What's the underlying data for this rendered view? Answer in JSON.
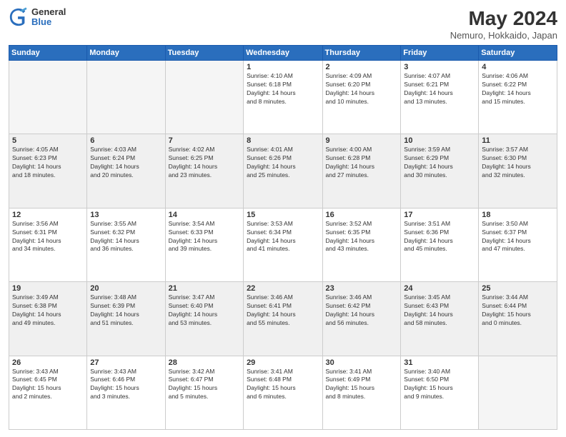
{
  "header": {
    "logo_general": "General",
    "logo_blue": "Blue",
    "title": "May 2024",
    "subtitle": "Nemuro, Hokkaido, Japan"
  },
  "weekdays": [
    "Sunday",
    "Monday",
    "Tuesday",
    "Wednesday",
    "Thursday",
    "Friday",
    "Saturday"
  ],
  "weeks": [
    [
      {
        "day": "",
        "info": "",
        "empty": true
      },
      {
        "day": "",
        "info": "",
        "empty": true
      },
      {
        "day": "",
        "info": "",
        "empty": true
      },
      {
        "day": "1",
        "info": "Sunrise: 4:10 AM\nSunset: 6:18 PM\nDaylight: 14 hours\nand 8 minutes."
      },
      {
        "day": "2",
        "info": "Sunrise: 4:09 AM\nSunset: 6:20 PM\nDaylight: 14 hours\nand 10 minutes."
      },
      {
        "day": "3",
        "info": "Sunrise: 4:07 AM\nSunset: 6:21 PM\nDaylight: 14 hours\nand 13 minutes."
      },
      {
        "day": "4",
        "info": "Sunrise: 4:06 AM\nSunset: 6:22 PM\nDaylight: 14 hours\nand 15 minutes."
      }
    ],
    [
      {
        "day": "5",
        "info": "Sunrise: 4:05 AM\nSunset: 6:23 PM\nDaylight: 14 hours\nand 18 minutes."
      },
      {
        "day": "6",
        "info": "Sunrise: 4:03 AM\nSunset: 6:24 PM\nDaylight: 14 hours\nand 20 minutes."
      },
      {
        "day": "7",
        "info": "Sunrise: 4:02 AM\nSunset: 6:25 PM\nDaylight: 14 hours\nand 23 minutes."
      },
      {
        "day": "8",
        "info": "Sunrise: 4:01 AM\nSunset: 6:26 PM\nDaylight: 14 hours\nand 25 minutes."
      },
      {
        "day": "9",
        "info": "Sunrise: 4:00 AM\nSunset: 6:28 PM\nDaylight: 14 hours\nand 27 minutes."
      },
      {
        "day": "10",
        "info": "Sunrise: 3:59 AM\nSunset: 6:29 PM\nDaylight: 14 hours\nand 30 minutes."
      },
      {
        "day": "11",
        "info": "Sunrise: 3:57 AM\nSunset: 6:30 PM\nDaylight: 14 hours\nand 32 minutes."
      }
    ],
    [
      {
        "day": "12",
        "info": "Sunrise: 3:56 AM\nSunset: 6:31 PM\nDaylight: 14 hours\nand 34 minutes."
      },
      {
        "day": "13",
        "info": "Sunrise: 3:55 AM\nSunset: 6:32 PM\nDaylight: 14 hours\nand 36 minutes."
      },
      {
        "day": "14",
        "info": "Sunrise: 3:54 AM\nSunset: 6:33 PM\nDaylight: 14 hours\nand 39 minutes."
      },
      {
        "day": "15",
        "info": "Sunrise: 3:53 AM\nSunset: 6:34 PM\nDaylight: 14 hours\nand 41 minutes."
      },
      {
        "day": "16",
        "info": "Sunrise: 3:52 AM\nSunset: 6:35 PM\nDaylight: 14 hours\nand 43 minutes."
      },
      {
        "day": "17",
        "info": "Sunrise: 3:51 AM\nSunset: 6:36 PM\nDaylight: 14 hours\nand 45 minutes."
      },
      {
        "day": "18",
        "info": "Sunrise: 3:50 AM\nSunset: 6:37 PM\nDaylight: 14 hours\nand 47 minutes."
      }
    ],
    [
      {
        "day": "19",
        "info": "Sunrise: 3:49 AM\nSunset: 6:38 PM\nDaylight: 14 hours\nand 49 minutes."
      },
      {
        "day": "20",
        "info": "Sunrise: 3:48 AM\nSunset: 6:39 PM\nDaylight: 14 hours\nand 51 minutes."
      },
      {
        "day": "21",
        "info": "Sunrise: 3:47 AM\nSunset: 6:40 PM\nDaylight: 14 hours\nand 53 minutes."
      },
      {
        "day": "22",
        "info": "Sunrise: 3:46 AM\nSunset: 6:41 PM\nDaylight: 14 hours\nand 55 minutes."
      },
      {
        "day": "23",
        "info": "Sunrise: 3:46 AM\nSunset: 6:42 PM\nDaylight: 14 hours\nand 56 minutes."
      },
      {
        "day": "24",
        "info": "Sunrise: 3:45 AM\nSunset: 6:43 PM\nDaylight: 14 hours\nand 58 minutes."
      },
      {
        "day": "25",
        "info": "Sunrise: 3:44 AM\nSunset: 6:44 PM\nDaylight: 15 hours\nand 0 minutes."
      }
    ],
    [
      {
        "day": "26",
        "info": "Sunrise: 3:43 AM\nSunset: 6:45 PM\nDaylight: 15 hours\nand 2 minutes."
      },
      {
        "day": "27",
        "info": "Sunrise: 3:43 AM\nSunset: 6:46 PM\nDaylight: 15 hours\nand 3 minutes."
      },
      {
        "day": "28",
        "info": "Sunrise: 3:42 AM\nSunset: 6:47 PM\nDaylight: 15 hours\nand 5 minutes."
      },
      {
        "day": "29",
        "info": "Sunrise: 3:41 AM\nSunset: 6:48 PM\nDaylight: 15 hours\nand 6 minutes."
      },
      {
        "day": "30",
        "info": "Sunrise: 3:41 AM\nSunset: 6:49 PM\nDaylight: 15 hours\nand 8 minutes."
      },
      {
        "day": "31",
        "info": "Sunrise: 3:40 AM\nSunset: 6:50 PM\nDaylight: 15 hours\nand 9 minutes."
      },
      {
        "day": "",
        "info": "",
        "empty": true
      }
    ]
  ]
}
